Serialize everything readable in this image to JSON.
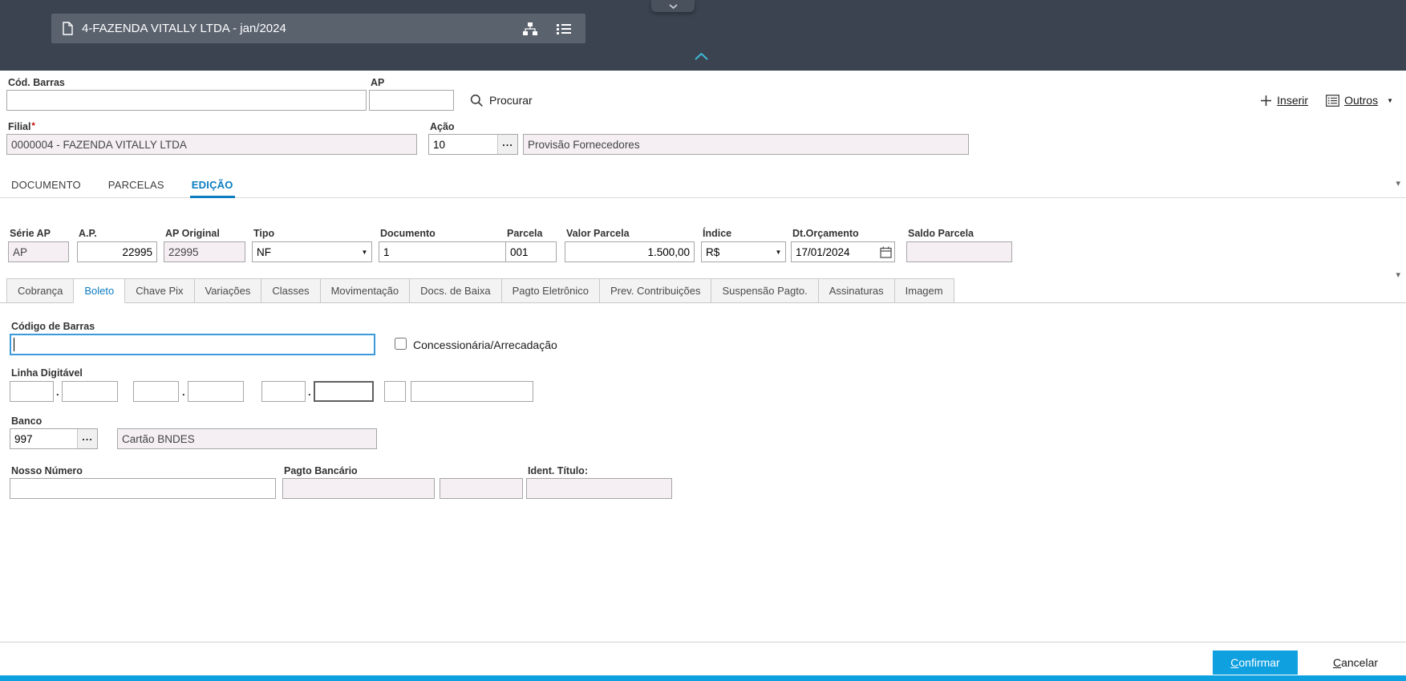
{
  "header": {
    "document_tab": "4-FAZENDA VITALLY LTDA - jan/2024"
  },
  "toolbar": {
    "cod_barras": {
      "label": "Cód. Barras",
      "value": ""
    },
    "ap": {
      "label": "AP",
      "value": ""
    },
    "procurar": "Procurar",
    "inserir": "Inserir",
    "outros": "Outros"
  },
  "filial": {
    "label": "Filial",
    "required_marker": "*",
    "value": "0000004 - FAZENDA VITALLY LTDA"
  },
  "acao": {
    "label": "Ação",
    "code": "10",
    "description": "Provisão Fornecedores"
  },
  "main_tabs": [
    {
      "label": "DOCUMENTO",
      "active": false
    },
    {
      "label": "PARCELAS",
      "active": false
    },
    {
      "label": "EDIÇÃO",
      "active": true
    }
  ],
  "fields": [
    {
      "label": "Série AP",
      "value": "AP",
      "readonly": true
    },
    {
      "label": "A.P.",
      "value": "22995",
      "readonly": false
    },
    {
      "label": "AP Original",
      "value": "22995",
      "readonly": true
    },
    {
      "label": "Tipo",
      "value": "NF",
      "type": "select"
    },
    {
      "label": "Documento",
      "value": "1",
      "readonly": false
    },
    {
      "label": "Parcela",
      "value": "001",
      "readonly": false
    },
    {
      "label": "Valor Parcela",
      "value": "1.500,00",
      "readonly": false
    },
    {
      "label": "Índice",
      "value": "R$",
      "type": "select"
    },
    {
      "label": "Dt.Orçamento",
      "value": "17/01/2024",
      "type": "date"
    },
    {
      "label": "Saldo Parcela",
      "value": "",
      "readonly": true
    }
  ],
  "sub_tabs": [
    {
      "label": "Cobrança",
      "active": false
    },
    {
      "label": "Boleto",
      "active": true
    },
    {
      "label": "Chave Pix",
      "active": false
    },
    {
      "label": "Variações",
      "active": false
    },
    {
      "label": "Classes",
      "active": false
    },
    {
      "label": "Movimentação",
      "active": false
    },
    {
      "label": "Docs. de Baixa",
      "active": false
    },
    {
      "label": "Pagto Eletrônico",
      "active": false
    },
    {
      "label": "Prev. Contribuições",
      "active": false
    },
    {
      "label": "Suspensão Pagto.",
      "active": false
    },
    {
      "label": "Assinaturas",
      "active": false
    },
    {
      "label": "Imagem",
      "active": false
    }
  ],
  "boleto": {
    "codigo_barras_label": "Código de Barras",
    "codigo_barras_value": "",
    "concessionaria_label": "Concessionária/Arrecadação",
    "concessionaria_checked": false,
    "linha_digitavel_label": "Linha Digitável",
    "linha_values": [
      "",
      "",
      "",
      "",
      "",
      "",
      "",
      ""
    ],
    "banco_label": "Banco",
    "banco_code": "997",
    "banco_nome": "Cartão BNDES",
    "nosso_numero_label": "Nosso Número",
    "nosso_numero_value": "",
    "pagto_bancario_label": "Pagto Bancário",
    "pagto_bancario_value1": "",
    "pagto_bancario_value2": "",
    "ident_titulo_label": "Ident. Título:",
    "ident_titulo_value": ""
  },
  "footer": {
    "confirmar": "Confirmar",
    "cancelar": "Cancelar"
  },
  "icons": {
    "caret_down": "▼",
    "scroll_caret": "▾",
    "more": "..."
  },
  "colors": {
    "header_dark": "#3A434F",
    "accent_blue": "#0C7CC0",
    "button_blue": "#0FA0E0",
    "readonly_bg": "#F5EFF3"
  }
}
